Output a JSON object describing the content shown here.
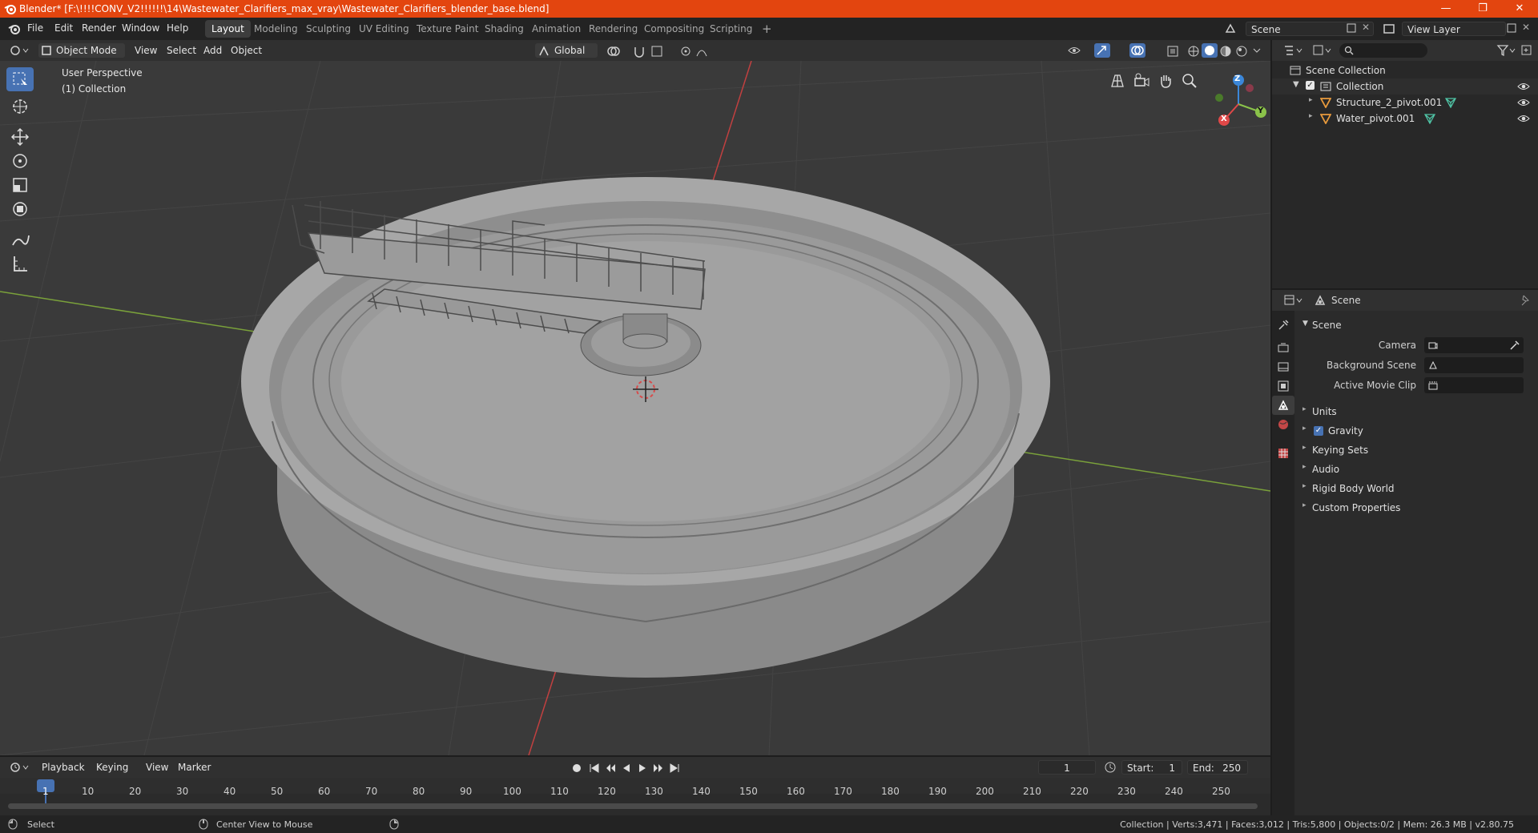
{
  "window": {
    "title": "Blender* [F:\\!!!!CONV_V2!!!!!!\\14\\Wastewater_Clarifiers_max_vray\\Wastewater_Clarifiers_blender_base.blend]",
    "minimize": "—",
    "maximize": "❐",
    "close": "✕"
  },
  "menu": [
    "File",
    "Edit",
    "Render",
    "Window",
    "Help"
  ],
  "workspaces": [
    "Layout",
    "Modeling",
    "Sculpting",
    "UV Editing",
    "Texture Paint",
    "Shading",
    "Animation",
    "Rendering",
    "Compositing",
    "Scripting"
  ],
  "workspace_add": "+",
  "scene_field": "Scene",
  "view_layer_field": "View Layer",
  "viewport_header": {
    "mode": "Object Mode",
    "menus": [
      "View",
      "Select",
      "Add",
      "Object"
    ],
    "orientation": "Global"
  },
  "viewport": {
    "perspective": "User Perspective",
    "collection": "(1) Collection",
    "gizmo": {
      "x": "X",
      "y": "Y",
      "z": "Z"
    }
  },
  "outliner": {
    "root": "Scene Collection",
    "collection": "Collection",
    "items": [
      "Structure_2_pivot.001",
      "Water_pivot.001"
    ]
  },
  "properties": {
    "header": "Scene",
    "section": "Scene",
    "fields": [
      {
        "label": "Camera"
      },
      {
        "label": "Background Scene"
      },
      {
        "label": "Active Movie Clip"
      }
    ],
    "panels": [
      "Units",
      "Gravity",
      "Keying Sets",
      "Audio",
      "Rigid Body World",
      "Custom Properties"
    ],
    "gravity_checked": true
  },
  "timeline": {
    "menus": [
      "Playback",
      "Keying",
      "View",
      "Marker"
    ],
    "current_frame": "1",
    "start_label": "Start:",
    "start": "1",
    "end_label": "End:",
    "end": "250",
    "ruler": [
      "1",
      "10",
      "20",
      "30",
      "40",
      "50",
      "60",
      "70",
      "80",
      "90",
      "100",
      "110",
      "120",
      "130",
      "140",
      "150",
      "160",
      "170",
      "180",
      "190",
      "200",
      "210",
      "220",
      "230",
      "240",
      "250"
    ]
  },
  "statusbar": {
    "left": "Select",
    "middle": "Center View to Mouse",
    "right": "Collection | Verts:3,471 | Faces:3,012 | Tris:5,800 | Objects:0/2 | Mem: 26.3 MB | v2.80.75"
  },
  "colors": {
    "titlebar": "#e3450f",
    "accent": "#4772b3",
    "x_axis": "#e04848",
    "y_axis": "#8bc34a",
    "z_axis": "#3b87d9",
    "object_icon": "#e89a3c",
    "mesh_icon": "#4fc3a5"
  }
}
